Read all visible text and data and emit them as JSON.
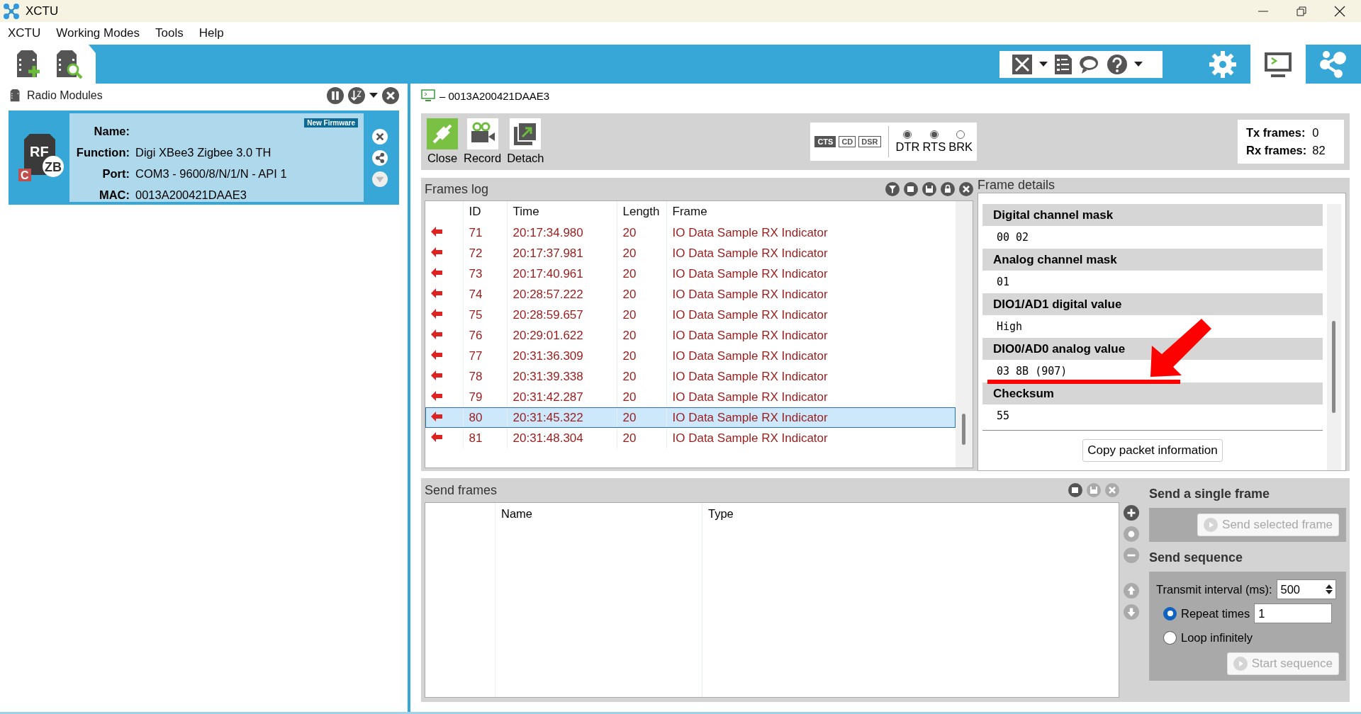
{
  "window": {
    "title": "XCTU"
  },
  "menu": [
    "XCTU",
    "Working Modes",
    "Tools",
    "Help"
  ],
  "top_tabs": [
    {
      "kind": "configuration",
      "selected": false
    },
    {
      "kind": "consoles",
      "selected": true
    },
    {
      "kind": "network",
      "selected": false
    }
  ],
  "radio_modules": {
    "title": "Radio Modules",
    "module": {
      "icon": {
        "main": "RF",
        "protocol": "ZB",
        "mark": "C"
      },
      "badge": "New Firmware",
      "fields": [
        {
          "label": "Name:"
        },
        {
          "label": "Function:",
          "value": "Digi XBee3 Zigbee 3.0 TH"
        },
        {
          "label": "Port:",
          "value": "COM3 - 9600/8/N/1/N - API 1"
        },
        {
          "label": "MAC:",
          "value": "0013A200421DAAE3"
        }
      ]
    }
  },
  "console": {
    "title": "– 0013A200421DAAE3",
    "buttons": [
      {
        "kind": "close",
        "label": "Close"
      },
      {
        "kind": "record",
        "label": "Record"
      },
      {
        "kind": "detach",
        "label": "Detach"
      }
    ],
    "lines": [
      {
        "label": "CTS",
        "on": true
      },
      {
        "label": "CD",
        "on": false
      },
      {
        "label": "DSR",
        "on": false
      }
    ],
    "signals": [
      {
        "label": "DTR",
        "on": true
      },
      {
        "label": "RTS",
        "on": true
      },
      {
        "label": "BRK",
        "on": false
      }
    ],
    "counters": [
      {
        "label": "Tx frames:",
        "value": "0"
      },
      {
        "label": "Rx frames:",
        "value": "82"
      }
    ]
  },
  "frames_log": {
    "title": "Frames log",
    "columns": [
      "ID",
      "Time",
      "Length",
      "Frame"
    ],
    "rows": [
      {
        "id": "71",
        "time": "20:17:34.980",
        "length": "20",
        "frame": "IO Data Sample RX Indicator",
        "selected": false
      },
      {
        "id": "72",
        "time": "20:17:37.981",
        "length": "20",
        "frame": "IO Data Sample RX Indicator",
        "selected": false
      },
      {
        "id": "73",
        "time": "20:17:40.961",
        "length": "20",
        "frame": "IO Data Sample RX Indicator",
        "selected": false
      },
      {
        "id": "74",
        "time": "20:28:57.222",
        "length": "20",
        "frame": "IO Data Sample RX Indicator",
        "selected": false
      },
      {
        "id": "75",
        "time": "20:28:59.657",
        "length": "20",
        "frame": "IO Data Sample RX Indicator",
        "selected": false
      },
      {
        "id": "76",
        "time": "20:29:01.622",
        "length": "20",
        "frame": "IO Data Sample RX Indicator",
        "selected": false
      },
      {
        "id": "77",
        "time": "20:31:36.309",
        "length": "20",
        "frame": "IO Data Sample RX Indicator",
        "selected": false
      },
      {
        "id": "78",
        "time": "20:31:39.338",
        "length": "20",
        "frame": "IO Data Sample RX Indicator",
        "selected": false
      },
      {
        "id": "79",
        "time": "20:31:42.287",
        "length": "20",
        "frame": "IO Data Sample RX Indicator",
        "selected": false
      },
      {
        "id": "80",
        "time": "20:31:45.322",
        "length": "20",
        "frame": "IO Data Sample RX Indicator",
        "selected": true
      },
      {
        "id": "81",
        "time": "20:31:48.304",
        "length": "20",
        "frame": "IO Data Sample RX Indicator",
        "selected": false
      }
    ]
  },
  "frame_details": {
    "title": "Frame details",
    "fields": [
      {
        "name": "Digital channel mask",
        "value": "00 02"
      },
      {
        "name": "Analog channel mask",
        "value": "01"
      },
      {
        "name": "DIO1/AD1 digital value",
        "value": "High"
      },
      {
        "name": "DIO0/AD0 analog value",
        "value": "03 8B (907)"
      },
      {
        "name": "Checksum",
        "value": "55"
      }
    ],
    "button": "Copy packet information"
  },
  "send_frames": {
    "title": "Send frames",
    "columns": [
      "Name",
      "Type"
    ]
  },
  "send_single": {
    "title": "Send a single frame",
    "button": "Send selected frame"
  },
  "send_sequence": {
    "title": "Send sequence",
    "interval_label": "Transmit interval (ms):",
    "interval": "500",
    "modes": [
      {
        "label": "Repeat times",
        "selected": true,
        "value": "1"
      },
      {
        "label": "Loop infinitely",
        "selected": false
      }
    ],
    "button": "Start sequence"
  }
}
